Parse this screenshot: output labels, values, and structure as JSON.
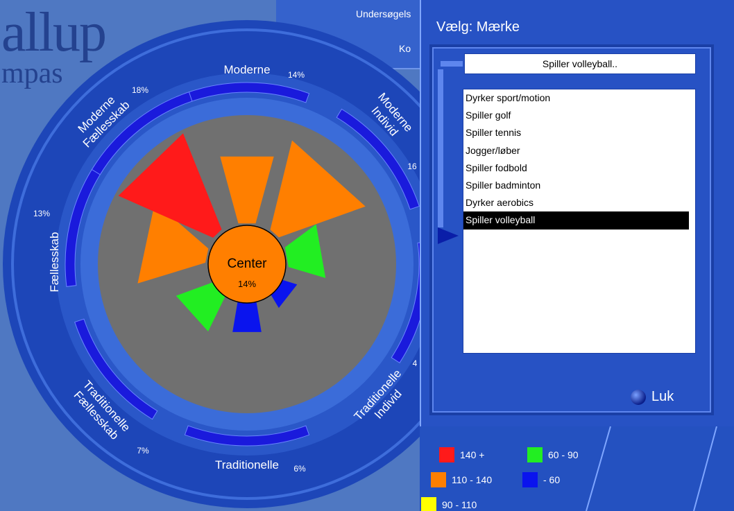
{
  "background": {
    "logo_line1": "allup",
    "logo_line2": "mpas",
    "header_line1": "Undersøgels",
    "header_line2": "Ko"
  },
  "wheel": {
    "segments": [
      {
        "label": "Moderne",
        "pct": "14%"
      },
      {
        "label": "Moderne Individ",
        "pct": "16"
      },
      {
        "label": "Traditionelle Individ",
        "pct": "4"
      },
      {
        "label": "Traditionelle",
        "pct": "6%"
      },
      {
        "label": "Traditionelle Fællesskab",
        "pct": "7%"
      },
      {
        "label": "Fællesskab",
        "pct": "13%"
      },
      {
        "label": "Moderne Fællesskab",
        "pct": "18%"
      }
    ],
    "center_label": "Center",
    "center_pct": "14%"
  },
  "panel": {
    "title": "Vælg: Mærke",
    "selected_value": "Spiller volleyball..",
    "options": [
      "Dyrker sport/motion",
      "Spiller golf",
      "Spiller tennis",
      "Jogger/løber",
      "Spiller fodbold",
      "Spiller badminton",
      "Dyrker aerobics",
      "Spiller volleyball"
    ],
    "selected_index": 7,
    "close_label": "Luk"
  },
  "legend": [
    {
      "label": "140 +",
      "color": "#ff1a1a"
    },
    {
      "label": "60 - 90",
      "color": "#22ee22"
    },
    {
      "label": "110 - 140",
      "color": "#ff7f00"
    },
    {
      "label": "- 60",
      "color": "#0a14ee"
    },
    {
      "label": "90 - 110",
      "color": "#ffff00"
    }
  ],
  "colors": {
    "background": "#4f78c2",
    "panel": "#2752c4",
    "ring_dark": "#1d46b8",
    "ring_light": "#3b6cd9",
    "band": "#1a1adc",
    "disc": "#707070",
    "center_fill": "#ff7f00",
    "red": "#ff1a1a",
    "orange": "#ff7f00",
    "green": "#22ee22",
    "blue": "#0a14ee"
  }
}
